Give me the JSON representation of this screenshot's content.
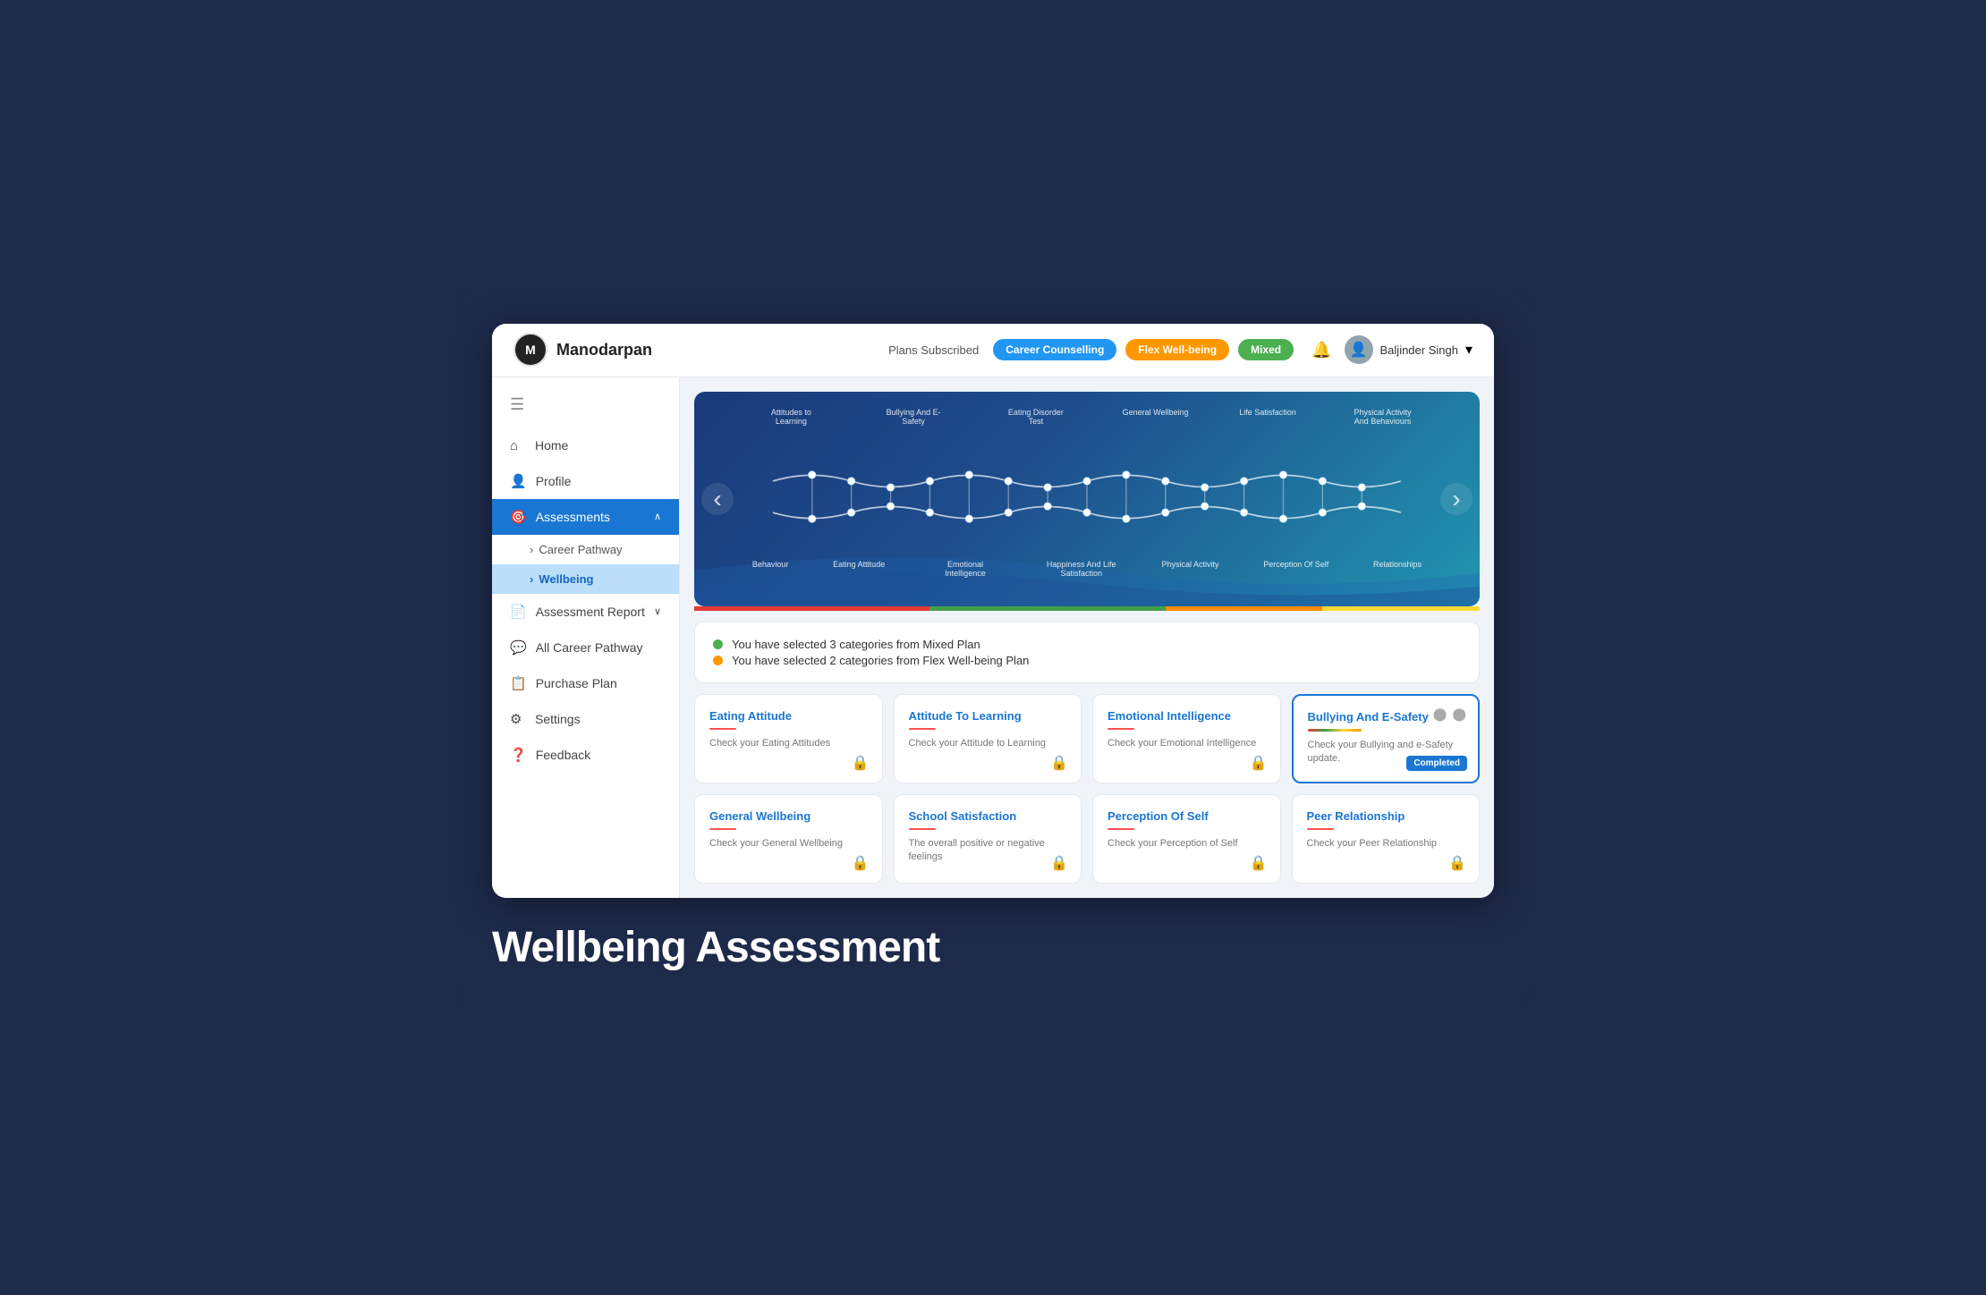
{
  "app": {
    "title": "Manodarpan",
    "logo_text": "M"
  },
  "header": {
    "plans_label": "Plans Subscribed",
    "badges": [
      {
        "label": "Career Counselling",
        "color": "badge-blue"
      },
      {
        "label": "Flex Well-being",
        "color": "badge-orange"
      },
      {
        "label": "Mixed",
        "color": "badge-green"
      }
    ],
    "user_name": "Baljinder Singh"
  },
  "sidebar": {
    "items": [
      {
        "label": "Home",
        "icon": "⌂",
        "key": "home"
      },
      {
        "label": "Profile",
        "icon": "👤",
        "key": "profile"
      },
      {
        "label": "Assessments",
        "icon": "🎯",
        "key": "assessments",
        "active": true,
        "expanded": true,
        "children": [
          {
            "label": "Career Pathway",
            "key": "career-pathway"
          },
          {
            "label": "Wellbeing",
            "key": "wellbeing",
            "active": true
          }
        ]
      },
      {
        "label": "Assessment Report",
        "icon": "📄",
        "key": "assessment-report"
      },
      {
        "label": "All Career Pathway",
        "icon": "💬",
        "key": "all-career-pathway"
      },
      {
        "label": "Purchase Plan",
        "icon": "📋",
        "key": "purchase-plan"
      },
      {
        "label": "Settings",
        "icon": "⚙",
        "key": "settings"
      },
      {
        "label": "Feedback",
        "icon": "❓",
        "key": "feedback"
      }
    ]
  },
  "banner": {
    "labels_top": [
      "Attitudes to Learning",
      "Bullying And E-Safety",
      "Eating Disorder Test",
      "General Wellbeing",
      "Life Satisfaction",
      "Physical Activity And Behaviours"
    ],
    "labels_bottom": [
      "Behaviour",
      "Eating Attitude",
      "Emotional Intelligence",
      "Happiness And Life Satisfaction",
      "Physical Activity",
      "Perception Of Self",
      "Relationships"
    ]
  },
  "color_bar": [
    {
      "color": "#e53935"
    },
    {
      "color": "#43a047"
    },
    {
      "color": "#fb8c00"
    },
    {
      "color": "#fdd835"
    }
  ],
  "selection_info": [
    {
      "dot": "dot-green",
      "text": "You have selected 3 categories from Mixed Plan"
    },
    {
      "dot": "dot-orange",
      "text": "You have selected 2 categories from Flex Well-being Plan"
    }
  ],
  "cards": [
    {
      "title": "Eating Attitude",
      "desc": "Check your Eating Attitudes",
      "completed": false,
      "locked": true
    },
    {
      "title": "Attitude To Learning",
      "desc": "Check your Attitude to Learning",
      "completed": false,
      "locked": true
    },
    {
      "title": "Emotional Intelligence",
      "desc": "Check your Emotional Intelligence",
      "completed": false,
      "locked": true
    },
    {
      "title": "Bullying And E-Safety",
      "desc": "Check your Bullying and e-Safety update.",
      "completed": true,
      "locked": false,
      "completed_label": "Completed"
    },
    {
      "title": "General Wellbeing",
      "desc": "Check your General Wellbeing",
      "completed": false,
      "locked": true
    },
    {
      "title": "School Satisfaction",
      "desc": "The overall positive or negative feelings",
      "completed": false,
      "locked": true
    },
    {
      "title": "Perception Of Self",
      "desc": "Check your Perception of Self",
      "completed": false,
      "locked": true
    },
    {
      "title": "Peer Relationship",
      "desc": "Check your Peer Relationship",
      "completed": false,
      "locked": true
    }
  ],
  "bottom_title": "Wellbeing Assessment"
}
